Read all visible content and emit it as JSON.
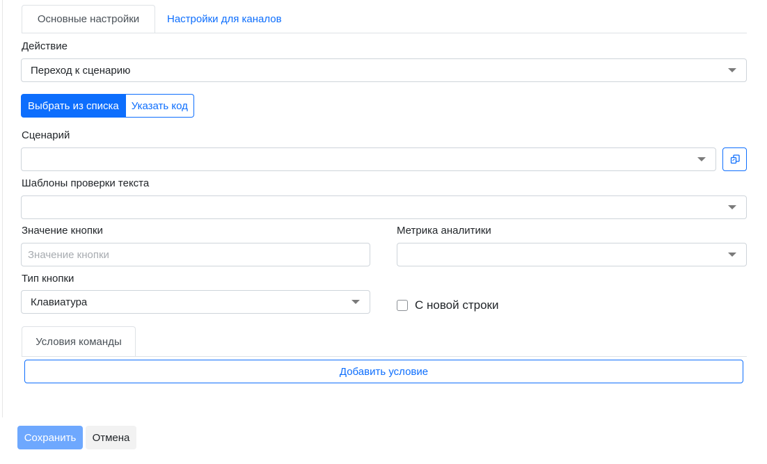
{
  "tabs": {
    "main": "Основные настройки",
    "channels": "Настройки для каналов"
  },
  "action": {
    "label": "Действие",
    "value": "Переход к сценарию"
  },
  "mode_toggle": {
    "from_list": "Выбрать из списка",
    "specify_code": "Указать код"
  },
  "scenario": {
    "label": "Сценарий",
    "value": ""
  },
  "text_templates": {
    "label": "Шаблоны проверки текста",
    "value": ""
  },
  "button_value": {
    "label": "Значение кнопки",
    "placeholder": "Значение кнопки"
  },
  "analytics_metric": {
    "label": "Метрика аналитики",
    "value": ""
  },
  "button_type": {
    "label": "Тип кнопки",
    "value": "Клавиатура"
  },
  "new_line": {
    "label": "С новой строки",
    "checked": false
  },
  "conditions": {
    "tab": "Условия команды",
    "add_button": "Добавить условие"
  },
  "footer": {
    "save": "Сохранить",
    "cancel": "Отмена"
  },
  "colors": {
    "primary": "#0d6efd",
    "save_disabled": "#6ea8fe",
    "border": "#ced4da"
  },
  "icons": {
    "copy": "copy-icon",
    "dropdown": "chevron-down-icon"
  }
}
